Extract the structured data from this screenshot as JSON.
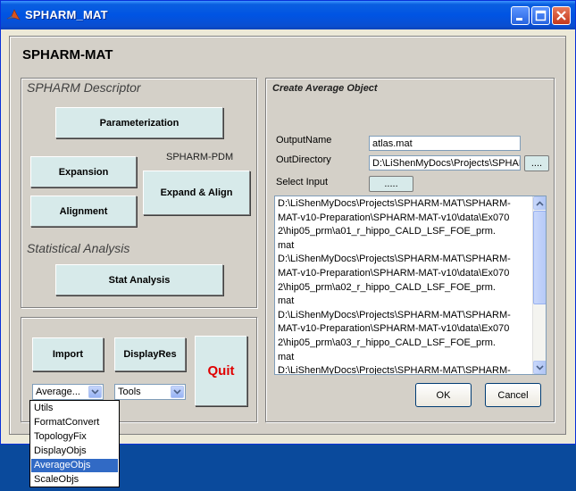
{
  "window": {
    "title": "SPHARM_MAT"
  },
  "app_title": "SPHARM-MAT",
  "descriptor_panel": {
    "title": "SPHARM Descriptor",
    "parameterization": "Parameterization",
    "expansion": "Expansion",
    "alignment": "Alignment",
    "pdm_label": "SPHARM-PDM",
    "expand_align": "Expand & Align",
    "stat_title": "Statistical Analysis",
    "stat_analysis": "Stat Analysis"
  },
  "bottom_panel": {
    "import": "Import",
    "display_res": "DisplayRes",
    "quit": "Quit",
    "select1_value": "Average...",
    "select2_value": "Tools"
  },
  "dropdown": {
    "items": [
      "Utils",
      "FormatConvert",
      "TopologyFix",
      "DisplayObjs",
      "AverageObjs",
      "ScaleObjs"
    ],
    "selected": "AverageObjs"
  },
  "right_panel": {
    "title": "Create Average Object",
    "output_name_label": "OutputName",
    "output_name_value": "atlas.mat",
    "out_dir_label": "OutDirectory",
    "out_dir_value": "D:\\LiShenMyDocs\\Projects\\SPHARM",
    "browse_dir": "....",
    "select_input_label": "Select Input",
    "browse_input": ".....",
    "input_lines": [
      "D:\\LiShenMyDocs\\Projects\\SPHARM-MAT\\SPHARM-",
      "MAT-v10-Preparation\\SPHARM-MAT-v10\\data\\Ex070",
      "2\\hip05_prm\\a01_r_hippo_CALD_LSF_FOE_prm.",
      "mat",
      "D:\\LiShenMyDocs\\Projects\\SPHARM-MAT\\SPHARM-",
      "MAT-v10-Preparation\\SPHARM-MAT-v10\\data\\Ex070",
      "2\\hip05_prm\\a02_r_hippo_CALD_LSF_FOE_prm.",
      "mat",
      "D:\\LiShenMyDocs\\Projects\\SPHARM-MAT\\SPHARM-",
      "MAT-v10-Preparation\\SPHARM-MAT-v10\\data\\Ex070",
      "2\\hip05_prm\\a03_r_hippo_CALD_LSF_FOE_prm.",
      "mat",
      "D:\\LiShenMyDocs\\Projects\\SPHARM-MAT\\SPHARM-"
    ],
    "ok": "OK",
    "cancel": "Cancel"
  },
  "colors": {
    "quit_text": "#e00000",
    "button_face": "#d7eaea",
    "panel_bg": "#d4d0c8",
    "selection": "#316ac5"
  }
}
